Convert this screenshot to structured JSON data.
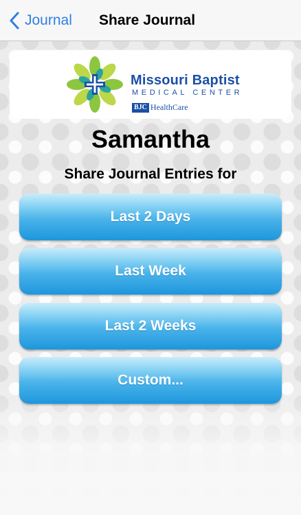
{
  "navbar": {
    "back_label": "Journal",
    "title": "Share Journal"
  },
  "logo": {
    "brand_name": "Missouri Baptist",
    "brand_sub": "MEDICAL CENTER",
    "bjc_mark": "BJC",
    "bjc_text": "HealthCare"
  },
  "patient": {
    "name": "Samantha"
  },
  "share": {
    "heading": "Share Journal Entries for",
    "options": [
      {
        "label": "Last 2 Days"
      },
      {
        "label": "Last Week"
      },
      {
        "label": "Last 2 Weeks"
      },
      {
        "label": "Custom..."
      }
    ]
  },
  "colors": {
    "nav_accent": "#2f7fe1",
    "brand_blue": "#1b4fa5",
    "button_top": "#c9ecfb",
    "button_bottom": "#1e96dc",
    "logo_green": "#8cc63f",
    "logo_teal": "#2aa4a0"
  },
  "icons": {
    "back": "chevron-left-icon",
    "logo": "medical-cross-flower-icon"
  }
}
